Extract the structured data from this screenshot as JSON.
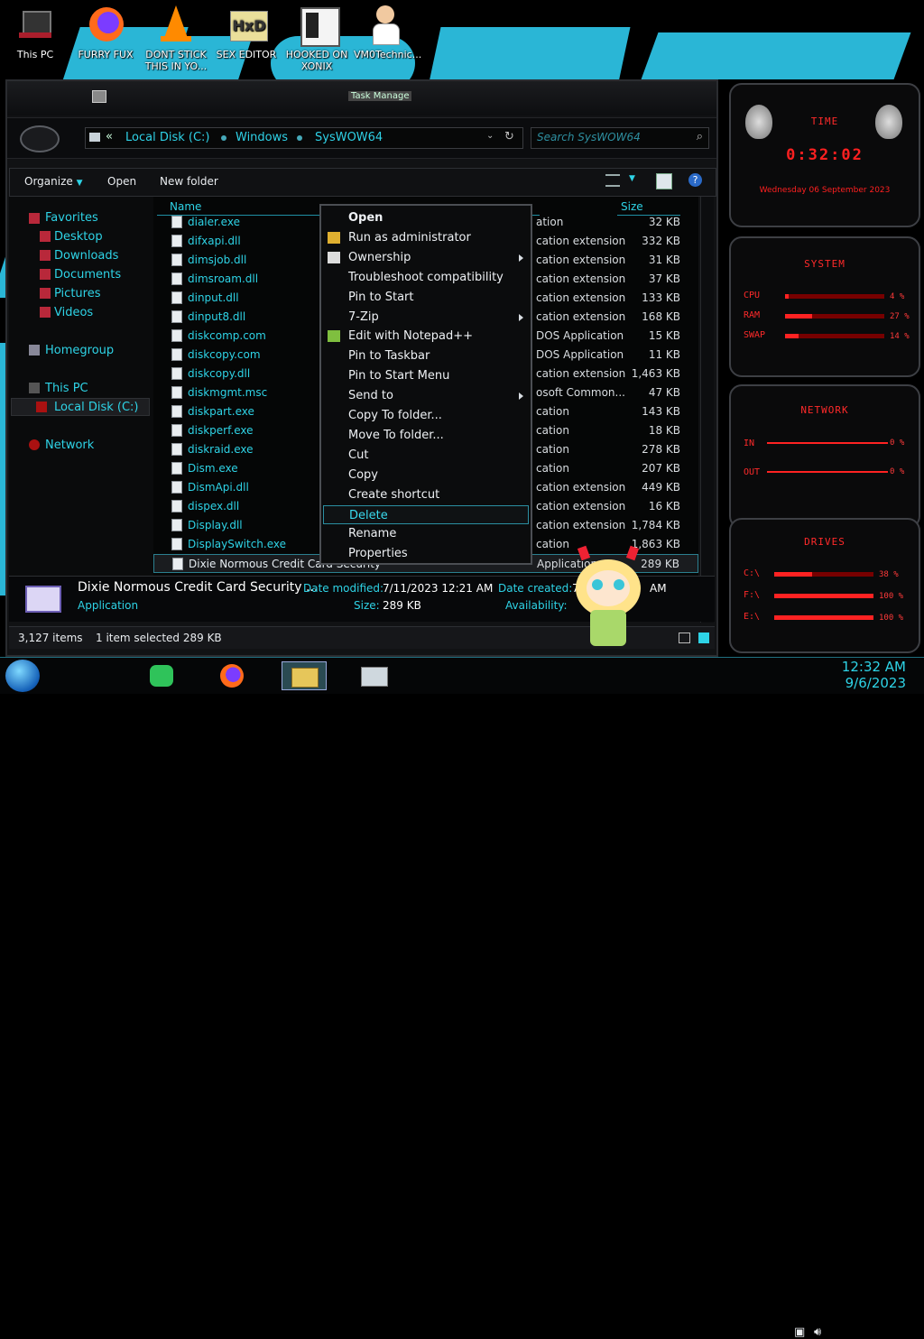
{
  "desktop": {
    "icons": [
      {
        "label": "This PC"
      },
      {
        "label": "FURRY FUX"
      },
      {
        "label": "DONT STICK THIS IN YO..."
      },
      {
        "label": "SEX EDITOR"
      },
      {
        "label": "HOOKED ON XONIX"
      },
      {
        "label": "VM0Technic..."
      }
    ]
  },
  "window": {
    "title": "Task Manage",
    "breadcrumb": [
      "Local Disk (C:)",
      "Windows",
      "SysWOW64"
    ],
    "search_placeholder": "Search SysWOW64",
    "toolbar": {
      "organize": "Organize",
      "open": "Open",
      "new_folder": "New folder"
    },
    "columns": {
      "name": "Name",
      "size": "Size"
    }
  },
  "nav": {
    "favorites": "Favorites",
    "items": [
      "Desktop",
      "Downloads",
      "Documents",
      "Pictures",
      "Videos"
    ],
    "homegroup": "Homegroup",
    "this_pc": "This PC",
    "local_disk": "Local Disk (C:)",
    "network": "Network"
  },
  "files": [
    {
      "name": "dialer.exe",
      "type": "ation",
      "size": "32 KB"
    },
    {
      "name": "difxapi.dll",
      "type": "cation extension",
      "size": "332 KB"
    },
    {
      "name": "dimsjob.dll",
      "type": "cation extension",
      "size": "31 KB"
    },
    {
      "name": "dimsroam.dll",
      "type": "cation extension",
      "size": "37 KB"
    },
    {
      "name": "dinput.dll",
      "type": "cation extension",
      "size": "133 KB"
    },
    {
      "name": "dinput8.dll",
      "type": "cation extension",
      "size": "168 KB"
    },
    {
      "name": "diskcomp.com",
      "type": "DOS Application",
      "size": "15 KB"
    },
    {
      "name": "diskcopy.com",
      "type": "DOS Application",
      "size": "11 KB"
    },
    {
      "name": "diskcopy.dll",
      "type": "cation extension",
      "size": "1,463 KB"
    },
    {
      "name": "diskmgmt.msc",
      "type": "osoft Common...",
      "size": "47 KB"
    },
    {
      "name": "diskpart.exe",
      "type": "cation",
      "size": "143 KB"
    },
    {
      "name": "diskperf.exe",
      "type": "cation",
      "size": "18 KB"
    },
    {
      "name": "diskraid.exe",
      "type": "cation",
      "size": "278 KB"
    },
    {
      "name": "Dism.exe",
      "type": "cation",
      "size": "207 KB"
    },
    {
      "name": "DismApi.dll",
      "type": "cation extension",
      "size": "449 KB"
    },
    {
      "name": "dispex.dll",
      "type": "cation extension",
      "size": "16 KB"
    },
    {
      "name": "Display.dll",
      "type": "cation extension",
      "size": "1,784 KB"
    },
    {
      "name": "DisplaySwitch.exe",
      "type": "cation",
      "size": "1,863 KB"
    },
    {
      "name": "Dixie Normous Credit Card Security",
      "type": "Application",
      "size": "289 KB"
    }
  ],
  "context_menu": [
    {
      "label": "Open"
    },
    {
      "label": "Run as administrator"
    },
    {
      "label": "Ownership"
    },
    {
      "label": "Troubleshoot compatibility"
    },
    {
      "label": "Pin to Start"
    },
    {
      "label": "7-Zip"
    },
    {
      "label": "Edit with Notepad++"
    },
    {
      "label": "Pin to Taskbar"
    },
    {
      "label": "Pin to Start Menu"
    },
    {
      "label": "Send to"
    },
    {
      "label": "Copy To folder..."
    },
    {
      "label": "Move To folder..."
    },
    {
      "label": "Cut"
    },
    {
      "label": "Copy"
    },
    {
      "label": "Create shortcut"
    },
    {
      "label": "Delete"
    },
    {
      "label": "Rename"
    },
    {
      "label": "Properties"
    }
  ],
  "details": {
    "name": "Dixie Normous Credit Card Security ...",
    "type": "Application",
    "date_modified_label": "Date modified:",
    "date_modified": "7/11/2023 12:21 AM",
    "size_label": "Size:",
    "size": "289 KB",
    "date_created_label": "Date created:",
    "date_created": "7/",
    "date_created_tail": "AM",
    "availability_label": "Availability:"
  },
  "status": {
    "count": "3,127 items",
    "selection": "1 item selected  289 KB"
  },
  "gadgets": {
    "time": {
      "title": "TIME",
      "clock": "0:32:02",
      "date": "Wednesday 06 September 2023"
    },
    "system": {
      "title": "SYSTEM",
      "cpu_label": "CPU",
      "cpu": "4 %",
      "cpu_level": 0.04,
      "ram_label": "RAM",
      "ram": "27 %",
      "ram_level": 0.27,
      "swap_label": "SWAP",
      "swap": "14 %",
      "swap_level": 0.14
    },
    "network": {
      "title": "NETWORK",
      "in_label": "IN",
      "in": "0 %",
      "out_label": "OUT",
      "out": "0 %"
    },
    "drives": {
      "title": "DRIVES",
      "c_label": "C:\\",
      "c": "38 %",
      "c_level": 0.38,
      "f_label": "F:\\",
      "f": "100 %",
      "f_level": 1.0,
      "e_label": "E:\\",
      "e": "100 %",
      "e_level": 1.0
    }
  },
  "taskbar": {
    "time": "12:32 AM",
    "date": "9/6/2023"
  }
}
